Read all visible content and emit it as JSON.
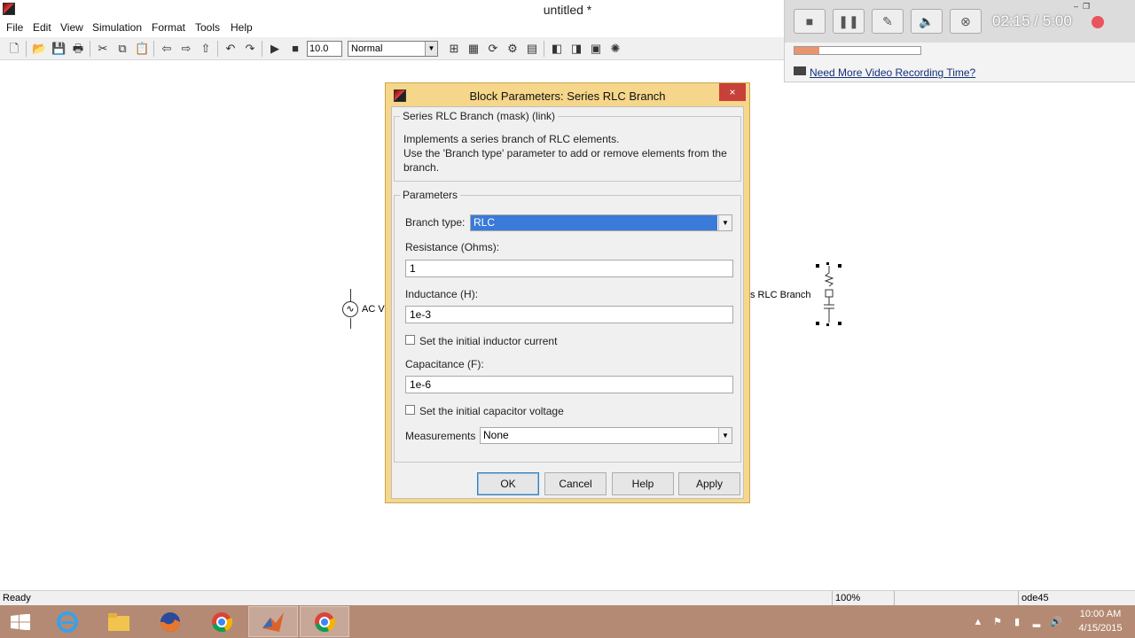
{
  "window": {
    "title": "untitled *"
  },
  "menu": [
    "File",
    "Edit",
    "View",
    "Simulation",
    "Format",
    "Tools",
    "Help"
  ],
  "toolbar": {
    "stop_time": "10.0",
    "sim_mode": "Normal"
  },
  "canvas": {
    "ac_label": "AC V",
    "rlc_label": "s RLC Branch"
  },
  "recorder": {
    "time": "02:15 / 5:00",
    "progress": 0.2,
    "link_text": "Need More Video Recording Time?"
  },
  "dialog": {
    "title": "Block Parameters: Series RLC Branch",
    "close": "×",
    "description_group": "Series RLC Branch (mask) (link)",
    "description_lines": [
      "Implements a series branch of RLC elements.",
      "Use the 'Branch type' parameter to add or remove elements from the",
      "branch."
    ],
    "parameters_group": "Parameters",
    "branch_type_label": "Branch type:",
    "branch_type_value": "RLC",
    "resistance_label": "Resistance (Ohms):",
    "resistance_value": "1",
    "inductance_label": "Inductance (H):",
    "inductance_value": "1e-3",
    "inductor_current_label": "Set the initial inductor current",
    "capacitance_label": "Capacitance (F):",
    "capacitance_value": "1e-6",
    "capacitor_voltage_label": "Set the initial capacitor voltage",
    "measurements_label": "Measurements",
    "measurements_value": "None",
    "buttons": {
      "ok": "OK",
      "cancel": "Cancel",
      "help": "Help",
      "apply": "Apply"
    }
  },
  "status": {
    "text": "Ready",
    "zoom": "100%",
    "solver": "ode45"
  },
  "clock": {
    "time": "10:00 AM",
    "date": "4/15/2015"
  },
  "colors": {
    "dialog_frame": "#f5d68a",
    "taskbar": "#b58a74",
    "selection": "#3a7ad8",
    "close_button": "#c7403a"
  }
}
